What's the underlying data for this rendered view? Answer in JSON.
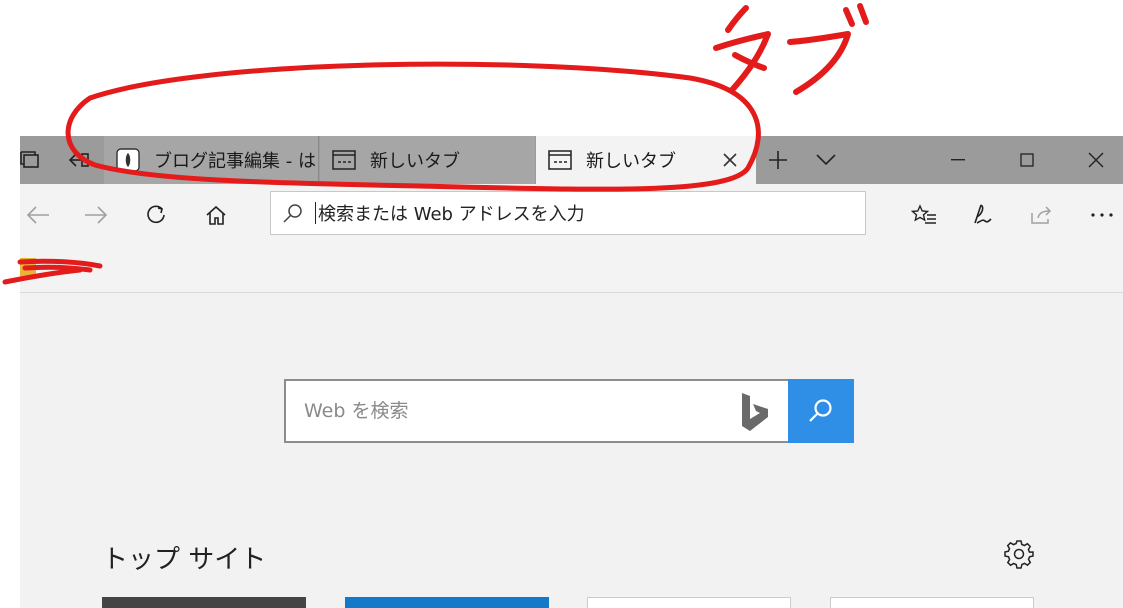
{
  "annotation": {
    "label": "タブ",
    "color": "#e31b1b"
  },
  "tabs": [
    {
      "title": "ブログ記事編集 - は",
      "icon": "blog-favicon",
      "active": false
    },
    {
      "title": "新しいタブ",
      "icon": "new-tab-page-icon",
      "active": false
    },
    {
      "title": "新しいタブ",
      "icon": "new-tab-page-icon",
      "active": true
    }
  ],
  "address_bar": {
    "placeholder": "検索または Web アドレスを入力"
  },
  "content": {
    "search_placeholder": "Web を検索",
    "top_sites_title": "トップ サイト",
    "tiles": [
      "#444444",
      "#1479c8",
      "#ffffff",
      "#ffffff"
    ]
  },
  "colors": {
    "accent": "#2f8ee6",
    "tabbar": "#9b9b9b",
    "chrome": "#f3f3f3"
  }
}
